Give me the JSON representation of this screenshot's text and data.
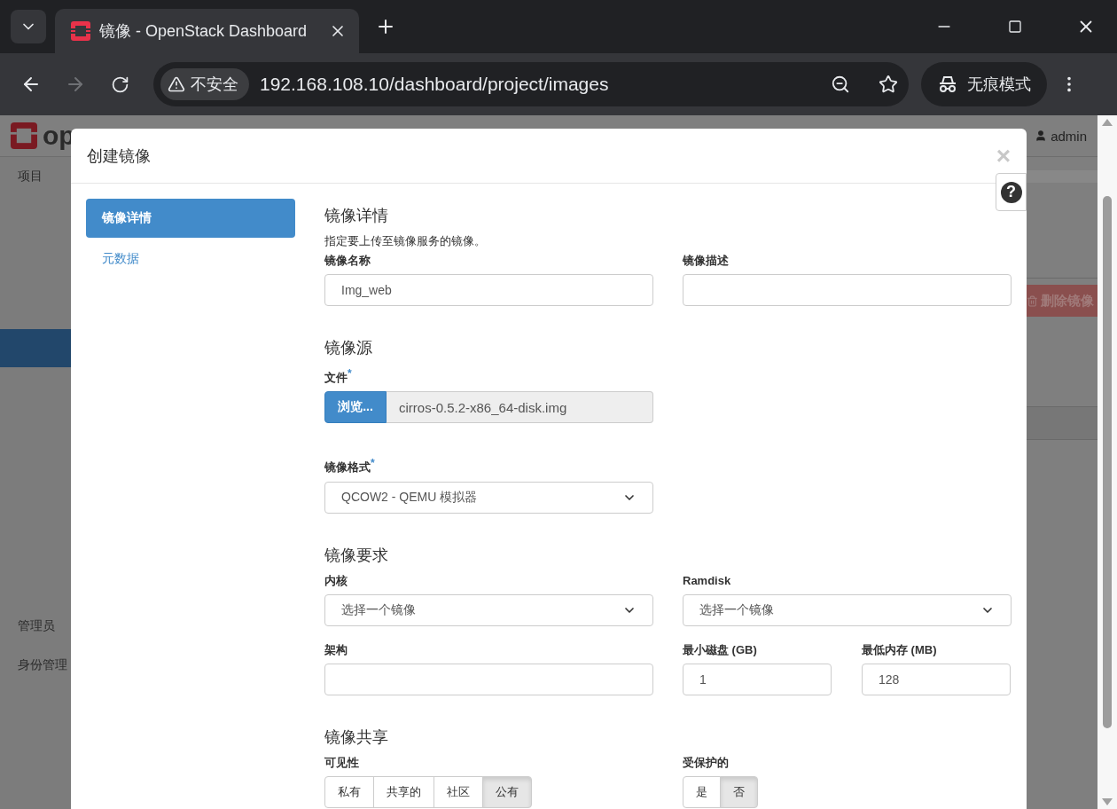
{
  "browser": {
    "tab_title": "镜像 - OpenStack Dashboard",
    "security_label": "不安全",
    "url": "192.168.108.10/dashboard/project/images",
    "profile_label": "无痕模式",
    "forward_enabled": false
  },
  "background_page": {
    "logo_text": "op",
    "user": "admin",
    "sidebar": [
      {
        "label": "项目"
      },
      {
        "label": "管理员"
      },
      {
        "label": "身份管理"
      }
    ],
    "action_button": "删除镜像"
  },
  "modal": {
    "title": "创建镜像",
    "close": "×",
    "help": "?",
    "steps": [
      {
        "label": "镜像详情",
        "selected": true
      },
      {
        "label": "元数据",
        "selected": false
      }
    ],
    "sections": [
      {
        "heading": "镜像详情",
        "description": "指定要上传至镜像服务的镜像。",
        "rows": [
          [
            {
              "kind": "text",
              "label": "镜像名称",
              "value": "Img_web"
            },
            {
              "kind": "text",
              "label": "镜像描述"
            }
          ]
        ]
      },
      {
        "heading": "镜像源",
        "rows": [
          [
            {
              "kind": "file",
              "label": "文件",
              "required_mark": "*",
              "button": "浏览...",
              "value": "cirros-0.5.2-x86_64-disk.img"
            }
          ],
          [
            {
              "kind": "select",
              "label": "镜像格式",
              "required_mark": "*",
              "value": "QCOW2 - QEMU 模拟器"
            }
          ]
        ]
      },
      {
        "heading": "镜像要求",
        "rows": [
          [
            {
              "kind": "select",
              "label": "内核",
              "value": "选择一个镜像"
            },
            {
              "kind": "select",
              "label": "Ramdisk",
              "value": "选择一个镜像"
            }
          ],
          [
            {
              "kind": "text",
              "label": "架构"
            },
            {
              "kind": "pair",
              "fields": [
                {
                  "kind": "text",
                  "label": "最小磁盘 (GB)",
                  "value": "1"
                },
                {
                  "kind": "text",
                  "label": "最低内存 (MB)",
                  "value": "128"
                }
              ]
            }
          ]
        ]
      },
      {
        "heading": "镜像共享",
        "rows": [
          [
            {
              "kind": "toggle",
              "label": "可见性",
              "options": [
                {
                  "label": "私有",
                  "selected": false
                },
                {
                  "label": "共享的",
                  "selected": false
                },
                {
                  "label": "社区",
                  "selected": false
                },
                {
                  "label": "公有",
                  "selected": true
                }
              ]
            },
            {
              "kind": "toggle",
              "label": "受保护的",
              "options": [
                {
                  "label": "是",
                  "selected": false
                },
                {
                  "label": "否",
                  "selected": true
                }
              ]
            }
          ]
        ]
      }
    ]
  }
}
